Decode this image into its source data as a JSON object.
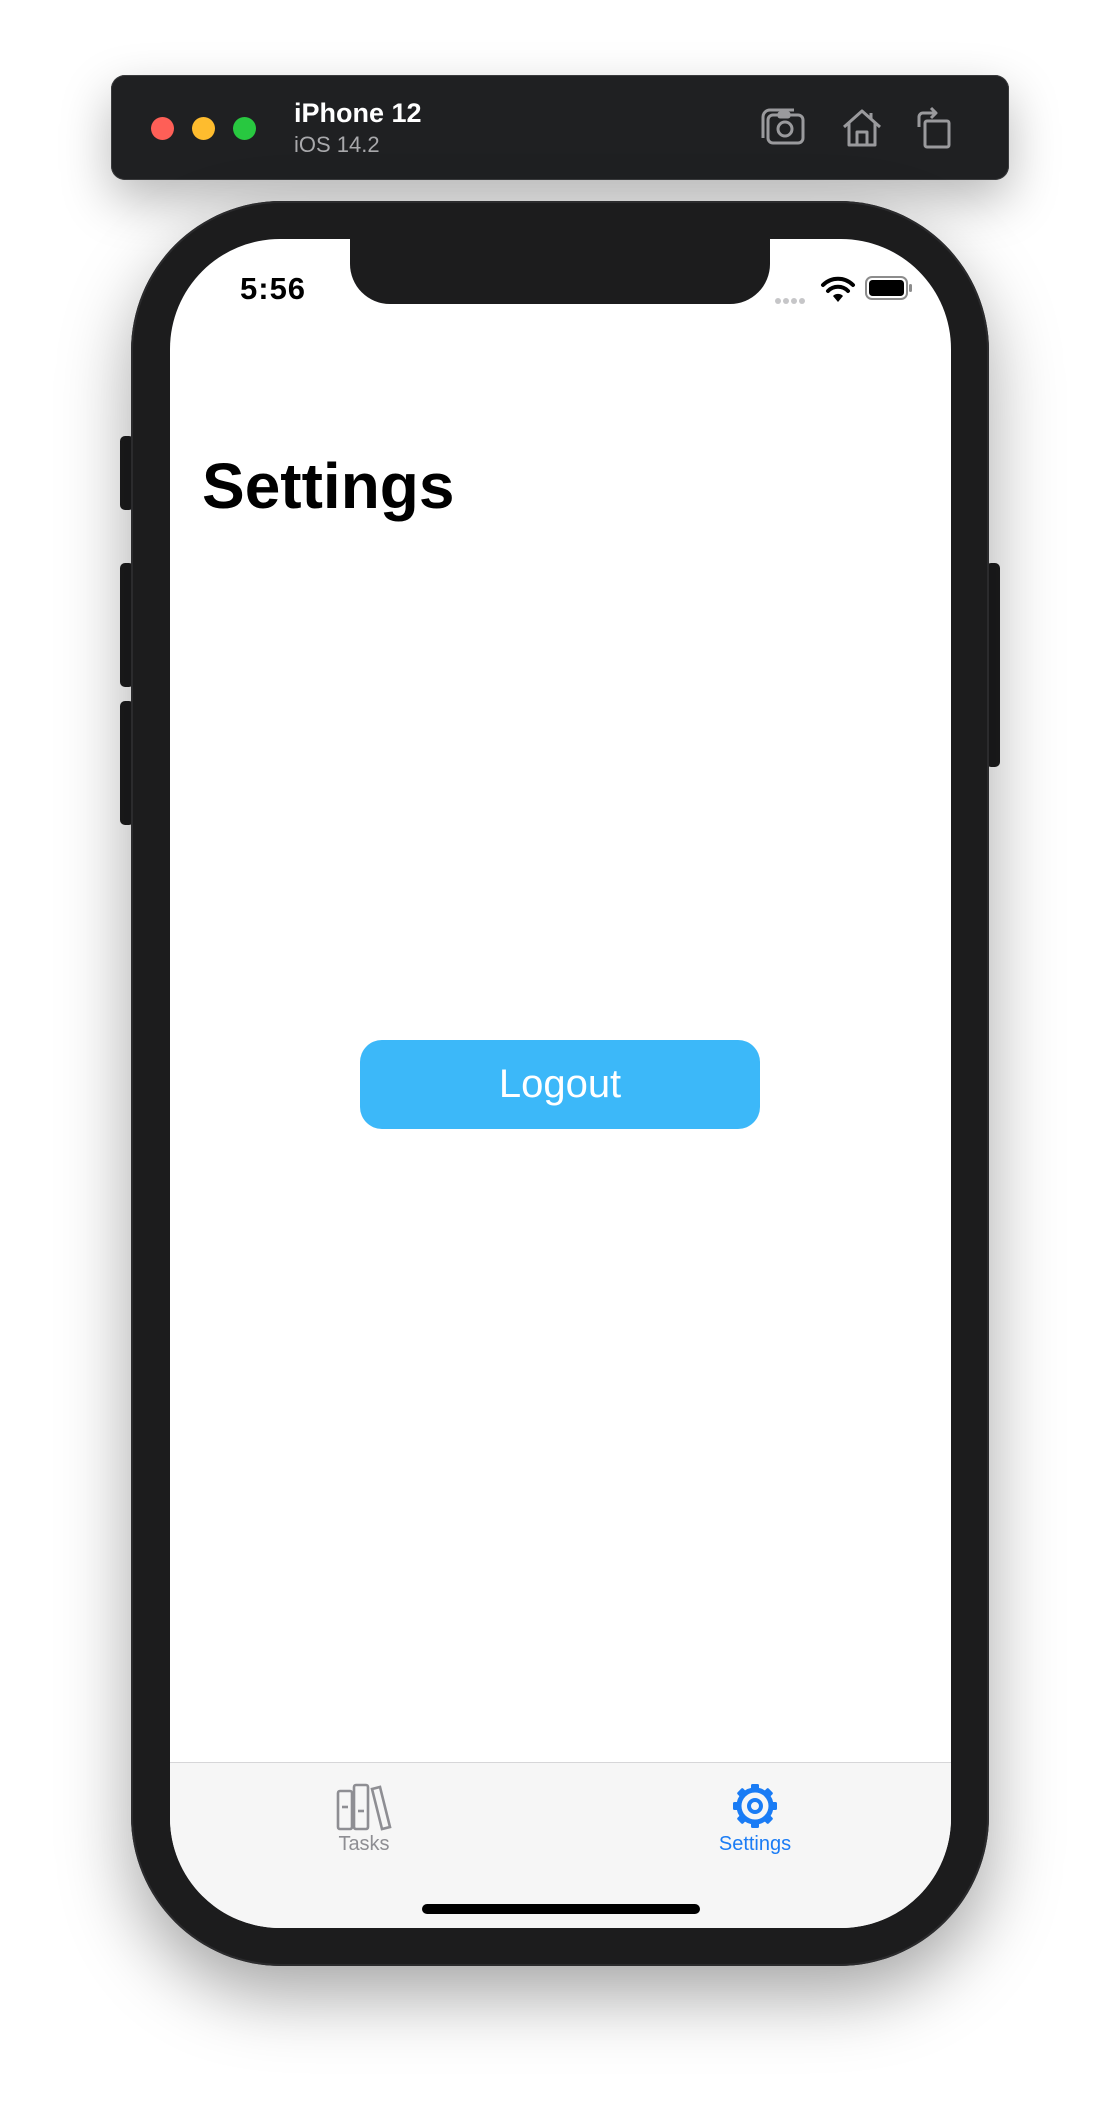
{
  "simulator": {
    "device_name": "iPhone 12",
    "os_version": "iOS 14.2",
    "icons": [
      "screenshot-icon",
      "home-icon",
      "rotate-icon"
    ]
  },
  "status_bar": {
    "time": "5:56",
    "icons": [
      "signal-icon",
      "wifi-icon",
      "battery-icon"
    ]
  },
  "page": {
    "title": "Settings"
  },
  "actions": {
    "logout_label": "Logout",
    "logout_color": "#3cb8f9"
  },
  "tab_bar": {
    "items": [
      {
        "label": "Tasks",
        "icon": "books-icon",
        "selected": false
      },
      {
        "label": "Settings",
        "icon": "gear-icon",
        "selected": true
      }
    ],
    "active_color": "#1a7cf5",
    "inactive_color": "#8e8e93"
  }
}
